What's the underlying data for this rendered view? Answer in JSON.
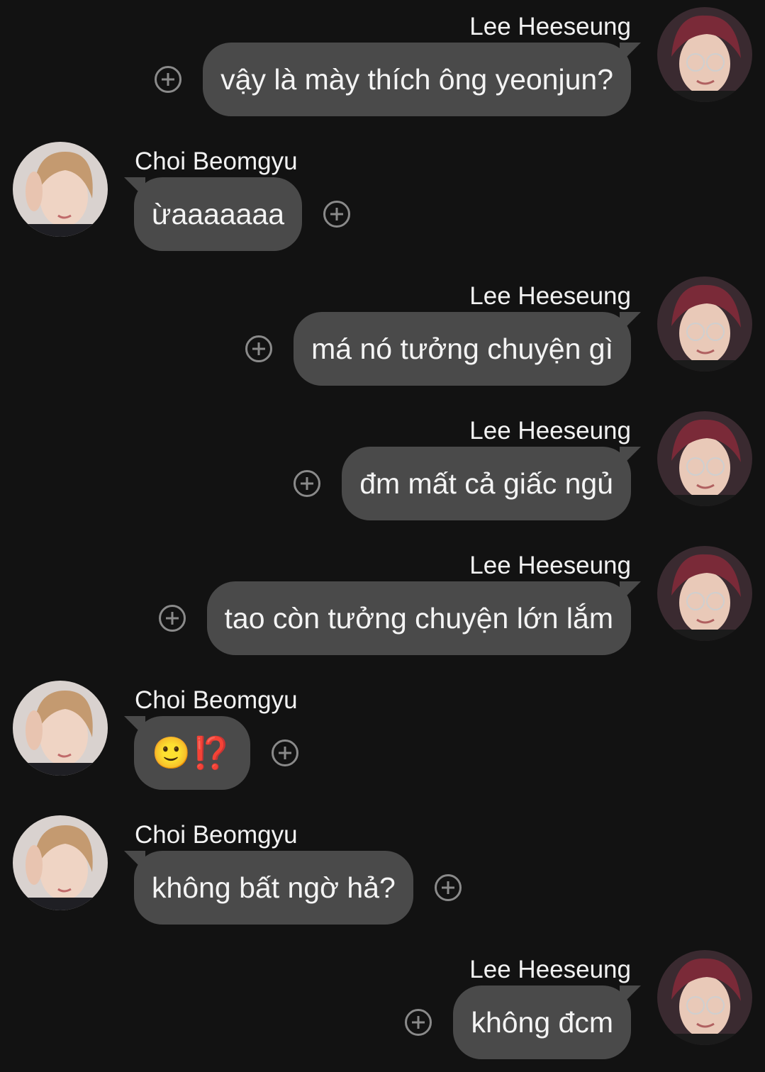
{
  "colors": {
    "background": "#121212",
    "bubble": "#4a4a4a",
    "text": "#f4f4f4",
    "add_reaction_icon": "#8a8a8a"
  },
  "messages": [
    {
      "direction": "out",
      "sender": "Lee Heeseung",
      "text": "vậy là mày thích ông yeonjun?"
    },
    {
      "direction": "in",
      "sender": "Choi Beomgyu",
      "text": "ừaaaaaaa"
    },
    {
      "direction": "out",
      "sender": "Lee Heeseung",
      "text": "má nó tưởng chuyện gì"
    },
    {
      "direction": "out",
      "sender": "Lee Heeseung",
      "text": "đm mất cả giấc ngủ"
    },
    {
      "direction": "out",
      "sender": "Lee Heeseung",
      "text": "tao còn tưởng chuyện lớn lắm"
    },
    {
      "direction": "in",
      "sender": "Choi Beomgyu",
      "text": "🙂⁉️"
    },
    {
      "direction": "in",
      "sender": "Choi Beomgyu",
      "text": "không bất ngờ hả?"
    },
    {
      "direction": "out",
      "sender": "Lee Heeseung",
      "text": "không đcm"
    }
  ],
  "icons": {
    "add_reaction": "plus-circle-icon",
    "avatar_lee": "avatar-lee-heeseung",
    "avatar_choi": "avatar-choi-beomgyu"
  }
}
